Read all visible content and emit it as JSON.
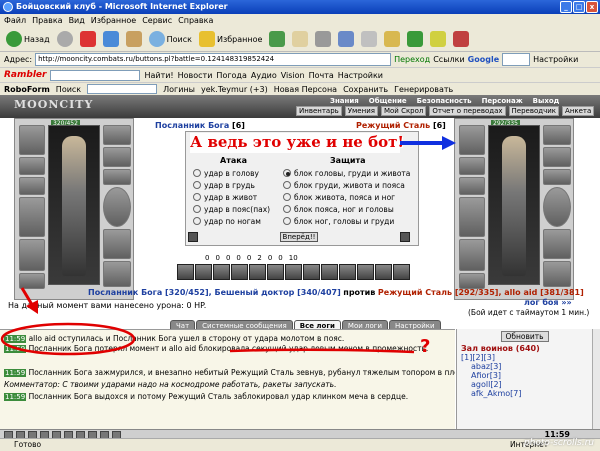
{
  "window": {
    "title": "Бойцовский клуб - Microsoft Internet Explorer"
  },
  "menu": [
    "Файл",
    "Правка",
    "Вид",
    "Избранное",
    "Сервис",
    "Справка"
  ],
  "toolbar": {
    "back": "Назад",
    "search": "Поиск",
    "favorites": "Избранное"
  },
  "address": {
    "label": "Адрес:",
    "url": "http://mooncity.combats.ru/buttons.pl?battle=0.124148319852424",
    "go": "Переход",
    "links": "Ссылки",
    "google": "Google",
    "settings": "Настройки"
  },
  "rambler": {
    "logo": "Rambler",
    "find": "Найти!",
    "items": [
      "Новости",
      "Погода",
      "Аудио",
      "Vision",
      "Почта",
      "Настройки"
    ]
  },
  "roboform": {
    "logo": "RoboForm",
    "search": "Поиск",
    "items": [
      "Логины",
      "yek.Teymur (+3)",
      "Новая Персона",
      "Сохранить",
      "Генерировать"
    ]
  },
  "game": {
    "logo": "MOONCITY",
    "nav1": [
      "Знания",
      "Общение",
      "Безопасность",
      "Персонаж",
      "Выход"
    ],
    "nav2": [
      "Инвентарь",
      "Умения",
      "Мой Скрол",
      "Отчет о переводах",
      "Переводчик",
      "Анкета"
    ],
    "left": {
      "hp": "320/452",
      "name": "Посланник Бога",
      "level": "[6]"
    },
    "right": {
      "hp": "292/335",
      "name": "Режущий Сталь",
      "level": "[6]"
    },
    "annotation": "А ведь это уже и не бот!",
    "attack_head": "Атака",
    "defense_head": "Защита",
    "attacks": [
      "удар в голову",
      "удар в грудь",
      "удар в живот",
      "удар в пояс(пах)",
      "удар по ногам"
    ],
    "defenses": [
      "блок головы, груди и живота",
      "блок груди, живота и пояса",
      "блок живота, пояса и ног",
      "блок пояса, ног и головы",
      "блок ног, головы и груди"
    ],
    "go": "Вперёд!!",
    "stats": [
      "0",
      "0",
      "0",
      "0",
      "0",
      "2",
      "0",
      "0",
      "10"
    ],
    "status_left": "Посланник Бога [320/452], Бешеный доктор [340/407]",
    "vs": "против",
    "status_right": "Режущий Сталь [292/335], allo aid [381/381]",
    "damage_line": "На данный момент вами нанесено урона: 0 HP.",
    "log_battle": "лог боя »»",
    "timeout": "(Бой идет с таймаутом 1 мин.)",
    "tabs": [
      "Чат",
      "Системные сообщения",
      "Все логи",
      "Мои логи",
      "Настройки"
    ],
    "log_lines": [
      {
        "ts": "11:59",
        "text": "allo aid оступилась и Посланник Бога ушел в сторону от удара молотом в пояс."
      },
      {
        "ts": "11:59",
        "text": "Посланник Бога потерял момент и allo aid блокировала секущий удар левым мечом в промежность."
      },
      {
        "ts": "11:59",
        "text": "Посланник Бога зажмурился, и внезапно небитый Режущий Сталь зевнув, рубанул тяжелым топором в плечо соперника. −3 [320/452]"
      },
      {
        "ts": "",
        "text": "Комментатор: С твоими ударами надо на космодроме работать, ракеты запускать."
      },
      {
        "ts": "11:59",
        "text": "Посланник Бога выдохся и потому Режущий Сталь заблокировал удар клинком меча в сердце."
      }
    ],
    "side": {
      "refresh": "Обновить",
      "hall": "Зал воинов (640)",
      "pages": "[1][2][3]",
      "players": [
        "abaz[3]",
        "Afior[3]",
        "agoll[2]",
        "afk_Akmo[7]"
      ]
    },
    "time": "11:59"
  },
  "status": {
    "text": "Готово",
    "zone": "Интернет"
  },
  "watermark": "photo-scrolls.ru"
}
